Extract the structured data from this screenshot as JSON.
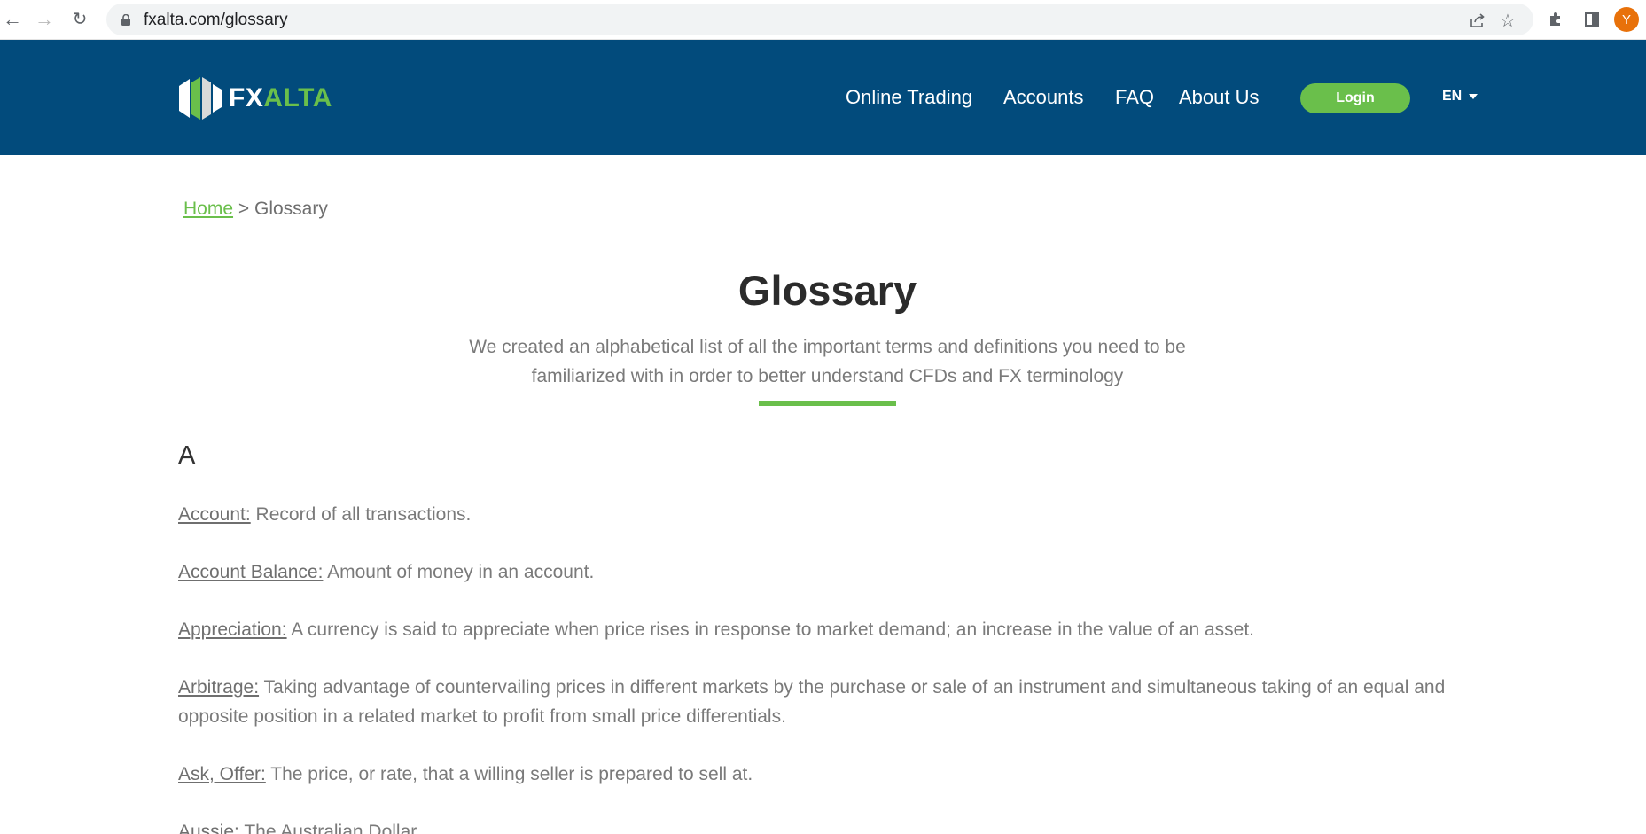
{
  "browser": {
    "url": "fxalta.com/glossary",
    "profile_initial": "Y"
  },
  "site": {
    "logo": {
      "fx": "FX",
      "alta": "ALTA"
    },
    "menu": [
      "Online Trading",
      "Accounts",
      "FAQ",
      "About Us"
    ],
    "login_label": "Login",
    "language": "EN"
  },
  "breadcrumb": {
    "home": "Home",
    "separator": ">",
    "current": "Glossary"
  },
  "page": {
    "title": "Glossary",
    "intro_line1": "We created an alphabetical list of all the important terms and definitions you need to be",
    "intro_line2": "familiarized with in order to better understand CFDs and FX terminology",
    "letter": "A"
  },
  "entries": [
    {
      "term": "Account:",
      "definition": " Record of all transactions."
    },
    {
      "term": "Account Balance:",
      "definition": " Amount of money in an account."
    },
    {
      "term": "Appreciation:",
      "definition": " A currency is said to appreciate when price rises in response to market demand; an increase in the value of an asset."
    },
    {
      "term": "Arbitrage:",
      "definition": " Taking advantage of countervailing prices in different markets by the purchase or sale of an instrument and simultaneous taking of an equal and opposite position in a related market to profit from small price differentials."
    },
    {
      "term": "Ask, Offer:",
      "definition": " The price, or rate, that a willing seller is prepared to sell at."
    },
    {
      "term": "Aussie:",
      "definition": " The Australian Dollar"
    }
  ],
  "colors": {
    "header_bg": "#024b7c",
    "accent_green": "#6abf4b"
  }
}
